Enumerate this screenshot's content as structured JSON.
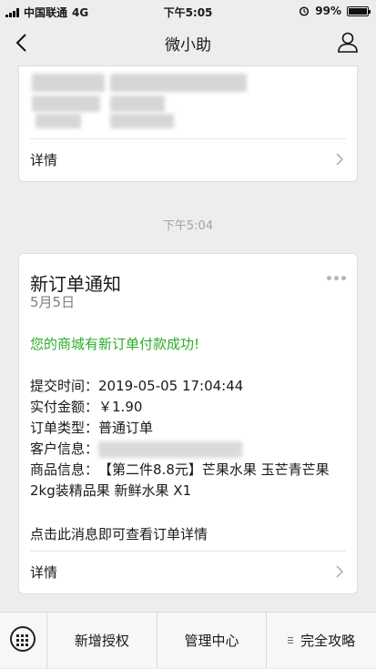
{
  "status": {
    "carrier": "中国联通",
    "network": "4G",
    "time": "下午5:05",
    "battery": "99%",
    "battery_level": 0.99
  },
  "nav": {
    "title": "微小助",
    "back_icon": "back-chevron-icon",
    "user_icon": "user-profile-icon"
  },
  "previous_card": {
    "detail_label": "详情"
  },
  "time_separator": "下午5:04",
  "message": {
    "title": "新订单通知",
    "date": "5月5日",
    "highlight": "您的商城有新订单付款成功!",
    "rows": [
      {
        "label": "提交时间：",
        "value": "2019-05-05 17:04:44"
      },
      {
        "label": "实付金额：",
        "value": "￥1.90"
      },
      {
        "label": "订单类型：",
        "value": "普通订单"
      },
      {
        "label": "客户信息：",
        "value": ""
      },
      {
        "label": "商品信息：",
        "value": "【第二件8.8元】芒果水果 玉芒青芒果 2kg装精品果 新鲜水果 X1"
      }
    ],
    "footer": "点击此消息即可查看订单详情",
    "detail_label": "详情"
  },
  "bottom_menu": {
    "items": [
      {
        "label": "新增授权"
      },
      {
        "label": "管理中心"
      },
      {
        "label": "完全攻略"
      }
    ]
  },
  "colors": {
    "background": "#ededed",
    "highlight_green": "#2bad2b",
    "card_border": "#dedede"
  }
}
